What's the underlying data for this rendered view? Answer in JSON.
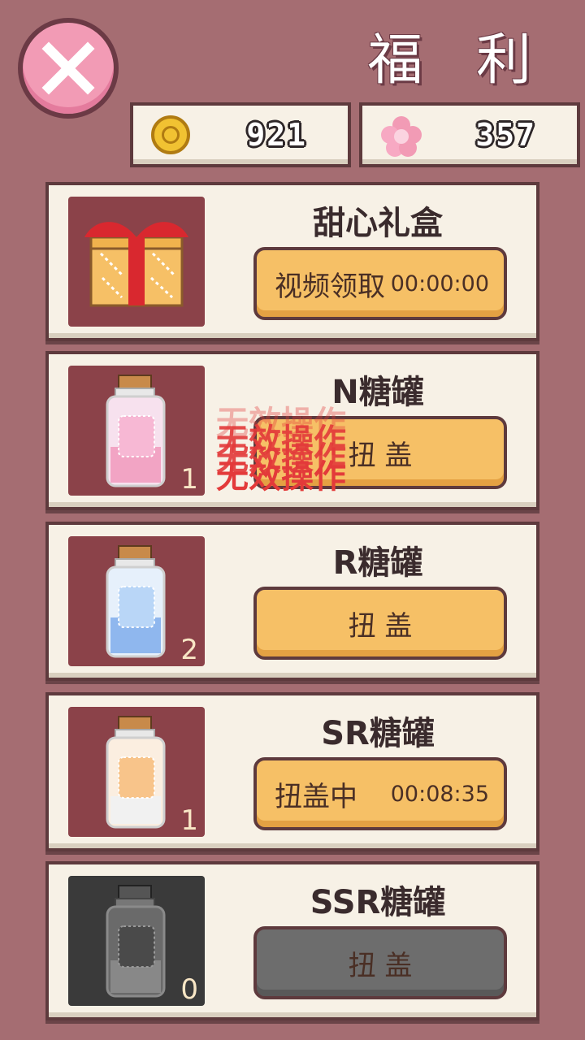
{
  "header": {
    "title": "福 利",
    "close_icon": "close-x-icon"
  },
  "currencies": {
    "coins": {
      "icon": "gold-coin-icon",
      "value": "921"
    },
    "flowers": {
      "icon": "pink-flower-icon",
      "value": "357"
    }
  },
  "cards": [
    {
      "name": "甜心礼盒",
      "icon": "gift-box-icon",
      "button_label": "视频领取",
      "button_time": "00:00:00"
    },
    {
      "name": "N糖罐",
      "icon": "pink-candy-jar-icon",
      "count": "1",
      "button_label": "扭 盖"
    },
    {
      "name": "R糖罐",
      "icon": "blue-candy-jar-icon",
      "count": "2",
      "button_label": "扭 盖"
    },
    {
      "name": "SR糖罐",
      "icon": "orange-candy-jar-icon",
      "count": "1",
      "button_label": "扭盖中",
      "button_time": "00:08:35"
    },
    {
      "name": "SSR糖罐",
      "icon": "gray-candy-jar-icon",
      "count": "0",
      "button_label": "扭 盖"
    }
  ],
  "toast": {
    "text": "无效操作"
  },
  "colors": {
    "background": "#a56d72",
    "card": "#f7f1e6",
    "button": "#f6c066",
    "button_disabled": "#6d6d6d",
    "thumb": "#8b4249",
    "toast": "#e33a3a"
  }
}
